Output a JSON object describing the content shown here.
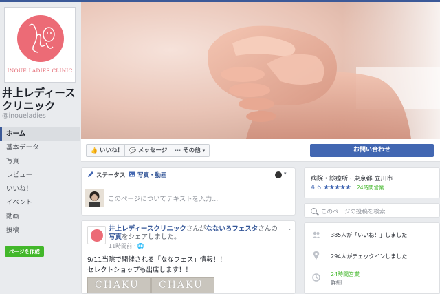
{
  "page": {
    "name": "井上レディースクリニック",
    "handle": "@inoueladies",
    "logo_text": "INOUE LADIES CLINIC"
  },
  "sidebar": {
    "items": [
      {
        "label": "ホーム",
        "active": true
      },
      {
        "label": "基本データ"
      },
      {
        "label": "写真"
      },
      {
        "label": "レビュー"
      },
      {
        "label": "いいね！"
      },
      {
        "label": "イベント"
      },
      {
        "label": "動画"
      },
      {
        "label": "投稿"
      }
    ],
    "create_page_label": "ページを作成"
  },
  "actions": {
    "like": "いいね！",
    "message": "メッセージ",
    "more": "その他",
    "contact": "お問い合わせ"
  },
  "composer": {
    "tab_status": "ステータス",
    "tab_photo": "写真・動画",
    "placeholder": "このページについてテキストを入力..."
  },
  "post": {
    "author": "井上レディースクリニック",
    "mid_text": "さんが",
    "shared_page": "なないろフェスタ",
    "suffix": "さんの",
    "photo_link": "写真",
    "share_text": "をシェアしました。",
    "time": "11時間前 · ",
    "line1": "9/11当院で開催される「ななフェス」情報！！",
    "line2": "セレクトショップも出店します！！",
    "image_text_1": "CHAKU",
    "image_text_2": "CHAKU"
  },
  "about": {
    "category": "病院・診療所 · 東京都 立川市",
    "rating": "4.6",
    "stars": "★★★★★",
    "open_status": "24時間営業"
  },
  "search": {
    "placeholder": "このページの投稿を検索"
  },
  "info": {
    "likes": "385人が「いいね！」しました",
    "checkins": "294人がチェックインしました",
    "hours": "24時間営業",
    "details": "詳細"
  },
  "colors": {
    "fb_blue": "#4267b2",
    "brand_pink": "#ec6b76",
    "green": "#42b72a"
  }
}
